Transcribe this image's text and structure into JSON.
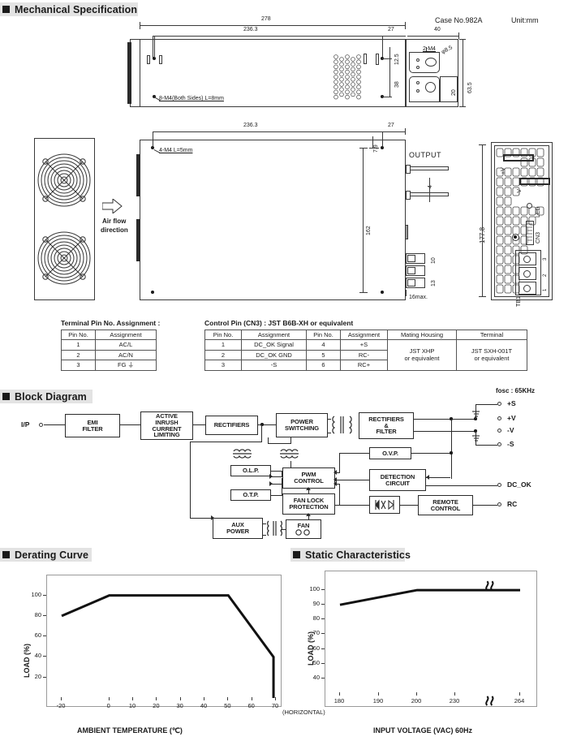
{
  "sections": {
    "mechanical": "Mechanical Specification",
    "block": "Block Diagram",
    "derating": "Derating Curve",
    "static": "Static Characteristics"
  },
  "mechanical": {
    "case_no": "Case No.982A",
    "unit": "Unit:mm",
    "dims": {
      "d278": "278",
      "d2363_top": "236.3",
      "d27_top": "27",
      "d40": "40",
      "d125": "12.5",
      "d38": "38",
      "d635": "63.5",
      "d20": "20",
      "d85": "φ8.5",
      "m4_2": "2-M4",
      "note_8m4": "8-M4(Both Sides) L=8mm",
      "d2363_mid": "236.3",
      "d27_mid": "27",
      "d79": "7.9",
      "d162": "162",
      "d4": "4",
      "d10": "10",
      "d13": "13",
      "d16max": "16max.",
      "d1778": "177.8",
      "note_4m4": "4-M4 L=5mm"
    },
    "labels": {
      "airflow_1": "Air flow",
      "airflow_2": "direction",
      "output": "OUTPUT",
      "plus_v": "+V",
      "minus_v": "-V",
      "led": "LED",
      "cn3": "CN3",
      "tb1": "TB1",
      "fg": "FG",
      "tb_pins": [
        "3",
        "2",
        "1"
      ]
    }
  },
  "terminal_table": {
    "caption": "Terminal Pin No. Assignment :",
    "headers": [
      "Pin No.",
      "Assignment"
    ],
    "rows": [
      [
        "1",
        "AC/L"
      ],
      [
        "2",
        "AC/N"
      ],
      [
        "3",
        "FG ⏚"
      ]
    ]
  },
  "control_table": {
    "caption": "Control Pin (CN3) : JST B6B-XH or equivalent",
    "headers": [
      "Pin No.",
      "Assignment",
      "Pin No.",
      "Assignment",
      "Mating Housing",
      "Terminal"
    ],
    "rows": [
      [
        "1",
        "DC_OK Signal",
        "4",
        "+S"
      ],
      [
        "2",
        "DC_OK GND",
        "5",
        "RC-"
      ],
      [
        "3",
        "-S",
        "6",
        "RC+"
      ]
    ],
    "mating_housing": "JST XHP\nor equivalent",
    "mating_housing_l1": "JST XHP",
    "mating_housing_l2": "or equivalent",
    "terminal_l1": "JST SXH-001T",
    "terminal_l2": "or equivalent"
  },
  "block_diagram": {
    "fosc": "fosc : 65KHz",
    "input_label": "I/P",
    "blocks": [
      {
        "id": "emi",
        "lines": [
          "EMI",
          "FILTER"
        ]
      },
      {
        "id": "inrush",
        "lines": [
          "ACTIVE",
          "INRUSH",
          "CURRENT",
          "LIMITING"
        ]
      },
      {
        "id": "rectifiers",
        "lines": [
          "RECTIFIERS"
        ]
      },
      {
        "id": "power_switching",
        "lines": [
          "POWER",
          "SWITCHING"
        ]
      },
      {
        "id": "rect_filter",
        "lines": [
          "RECTIFIERS",
          "&",
          "FILTER"
        ]
      },
      {
        "id": "olp",
        "lines": [
          "O.L.P."
        ]
      },
      {
        "id": "otp",
        "lines": [
          "O.T.P."
        ]
      },
      {
        "id": "ovp",
        "lines": [
          "O.V.P."
        ]
      },
      {
        "id": "pwm",
        "lines": [
          "PWM",
          "CONTROL"
        ]
      },
      {
        "id": "detection",
        "lines": [
          "DETECTION",
          "CIRCUIT"
        ]
      },
      {
        "id": "fan_lock",
        "lines": [
          "FAN LOCK",
          "PROTECTION"
        ]
      },
      {
        "id": "remote",
        "lines": [
          "REMOTE",
          "CONTROL"
        ]
      },
      {
        "id": "aux",
        "lines": [
          "AUX",
          "POWER"
        ]
      },
      {
        "id": "fan",
        "lines": [
          "FAN"
        ]
      }
    ],
    "outputs": [
      "+S",
      "+V",
      "-V",
      "-S",
      "DC_OK",
      "RC"
    ]
  },
  "chart_data": [
    {
      "type": "line",
      "id": "derating-curve",
      "title": "Derating Curve",
      "xlabel": "AMBIENT TEMPERATURE (℃)",
      "ylabel": "LOAD (%)",
      "xlim": [
        -20,
        70
      ],
      "ylim": [
        0,
        110
      ],
      "xticks": [
        "-20",
        "0",
        "10",
        "20",
        "30",
        "40",
        "50",
        "60",
        "70"
      ],
      "xtick_values": [
        -20,
        0,
        10,
        20,
        30,
        40,
        50,
        60,
        70
      ],
      "yticks": [
        "20",
        "40",
        "60",
        "80",
        "100"
      ],
      "ytick_values": [
        20,
        40,
        60,
        80,
        100
      ],
      "annotation": "(HORIZONTAL)",
      "grid": false,
      "series": [
        {
          "name": "load",
          "points": [
            [
              -20,
              80
            ],
            [
              0,
              100
            ],
            [
              50,
              100
            ],
            [
              69,
              40
            ],
            [
              69,
              0
            ]
          ]
        }
      ]
    },
    {
      "type": "line",
      "id": "static-characteristics",
      "title": "Static Characteristics",
      "xlabel": "INPUT VOLTAGE (VAC) 60Hz",
      "ylabel": "LOAD (%)",
      "xlim": [
        180,
        264
      ],
      "ylim": [
        30,
        105
      ],
      "xticks": [
        "180",
        "190",
        "200",
        "230",
        "264"
      ],
      "xtick_values": [
        180,
        190,
        200,
        230,
        264
      ],
      "yticks": [
        "40",
        "50",
        "60",
        "70",
        "80",
        "90",
        "100"
      ],
      "ytick_values": [
        40,
        50,
        60,
        70,
        80,
        90,
        100
      ],
      "break_marker": true,
      "grid": false,
      "series": [
        {
          "name": "load",
          "points": [
            [
              180,
              90
            ],
            [
              200,
              100
            ],
            [
              264,
              100
            ]
          ]
        }
      ]
    }
  ]
}
